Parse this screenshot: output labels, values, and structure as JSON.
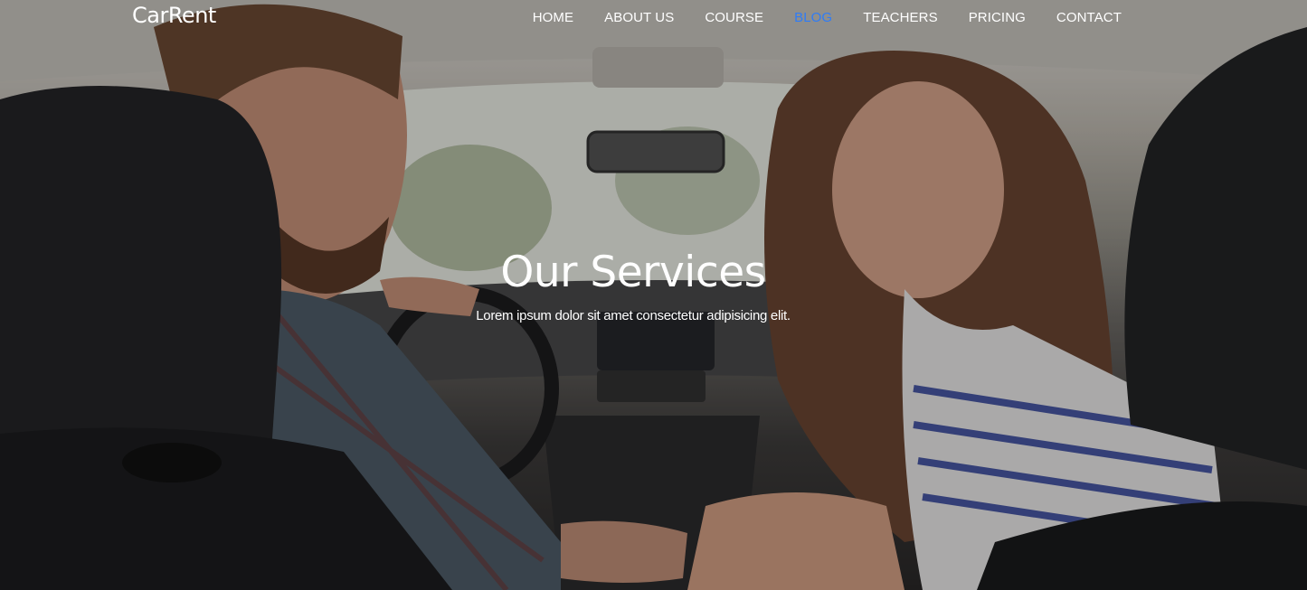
{
  "brand": {
    "name": "CarRent"
  },
  "nav": {
    "items": [
      {
        "label": "HOME"
      },
      {
        "label": "ABOUT US"
      },
      {
        "label": "COURSE"
      },
      {
        "label": "BLOG"
      },
      {
        "label": "TEACHERS"
      },
      {
        "label": "PRICING"
      },
      {
        "label": "CONTACT"
      }
    ],
    "active": "BLOG"
  },
  "hero": {
    "title": "Our Services",
    "subtitle": "Lorem ipsum dolor sit amet consectetur adipisicing elit."
  },
  "colors": {
    "active_link": "#2f7cf6",
    "text": "#ffffff"
  }
}
